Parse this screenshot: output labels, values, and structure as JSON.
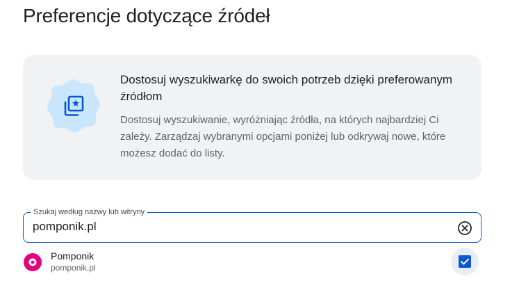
{
  "page": {
    "title": "Preferencje dotyczące źródeł"
  },
  "info_card": {
    "icon": "star-collection-icon",
    "title": "Dostosuj wyszukiwarkę do swoich potrzeb dzięki preferowanym źródłom",
    "description": "Dostosuj wyszukiwanie, wyróżniając źródła, na których najbardziej Ci zależy. Zarządzaj wybranymi opcjami poniżej lub odkrywaj nowe, które możesz dodać do listy."
  },
  "search": {
    "label": "Szukaj według nazwy lub witryny",
    "value": "pomponik.pl",
    "clear_icon": "clear-icon"
  },
  "results": [
    {
      "name": "Pomponik",
      "domain": "pomponik.pl",
      "favicon_color": "#e4007e",
      "checked": true
    }
  ],
  "colors": {
    "accent": "#0b57d0",
    "card_bg": "#f0f2f4",
    "icon_blob": "#c9e6fd",
    "icon_stroke": "#0b57d0"
  }
}
